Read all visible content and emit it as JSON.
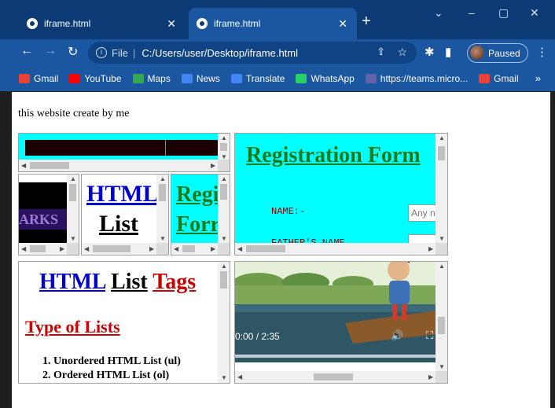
{
  "browser": {
    "tabs": [
      {
        "title": "iframe.html",
        "active": false
      },
      {
        "title": "iframe.html",
        "active": true
      }
    ],
    "new_tab": "+",
    "window_controls": {
      "chevron": "⌄",
      "minimize": "–",
      "maximize": "▢",
      "close": "✕"
    },
    "address": {
      "scheme_label": "File",
      "url": "C:/Users/user/Desktop/iframe.html"
    },
    "profile": {
      "label": "Paused"
    },
    "bookmarks": [
      {
        "label": "Gmail",
        "icon": "gmail-icon",
        "color": "#ea4335"
      },
      {
        "label": "YouTube",
        "icon": "youtube-icon",
        "color": "#ff0000"
      },
      {
        "label": "Maps",
        "icon": "maps-icon",
        "color": "#34a853"
      },
      {
        "label": "News",
        "icon": "news-icon",
        "color": "#4285f4"
      },
      {
        "label": "Translate",
        "icon": "translate-icon",
        "color": "#4285f4"
      },
      {
        "label": "WhatsApp",
        "icon": "whatsapp-icon",
        "color": "#25d366"
      },
      {
        "label": "https://teams.micro...",
        "icon": "teams-icon",
        "color": "#6264a7"
      },
      {
        "label": "Gmail",
        "icon": "gmail-icon",
        "color": "#ea4335"
      }
    ],
    "bookmarks_more": "»"
  },
  "page": {
    "caption": "this website create by me",
    "frame_small_1": {
      "text": "ARKS"
    },
    "frame_small_2": {
      "word1": "HTML",
      "word2": "List"
    },
    "frame_small_3": {
      "word1": "Regi",
      "word2": "Forr"
    },
    "registration": {
      "title": "Registration Form",
      "name_label": "NAME:-",
      "name_placeholder": "Any n",
      "father_label": "FATHER'S NAME"
    },
    "list_frame": {
      "title_a": "HTML",
      "title_b": "List",
      "title_c": "Tags",
      "subtitle": "Type of Lists",
      "items": [
        "Unordered HTML List (ul)",
        "Ordered HTML List (ol)"
      ]
    },
    "video": {
      "time": "0:00 / 2:35",
      "volume_icon": "🔊",
      "fullscreen_icon": "⛶"
    }
  },
  "colors": {
    "chrome_dark": "#0b3a75",
    "chrome": "#1b56a1",
    "cyan": "#00ffff",
    "green_title": "#1a7a1a",
    "red": "#cc0000",
    "blue": "#0000cc"
  }
}
